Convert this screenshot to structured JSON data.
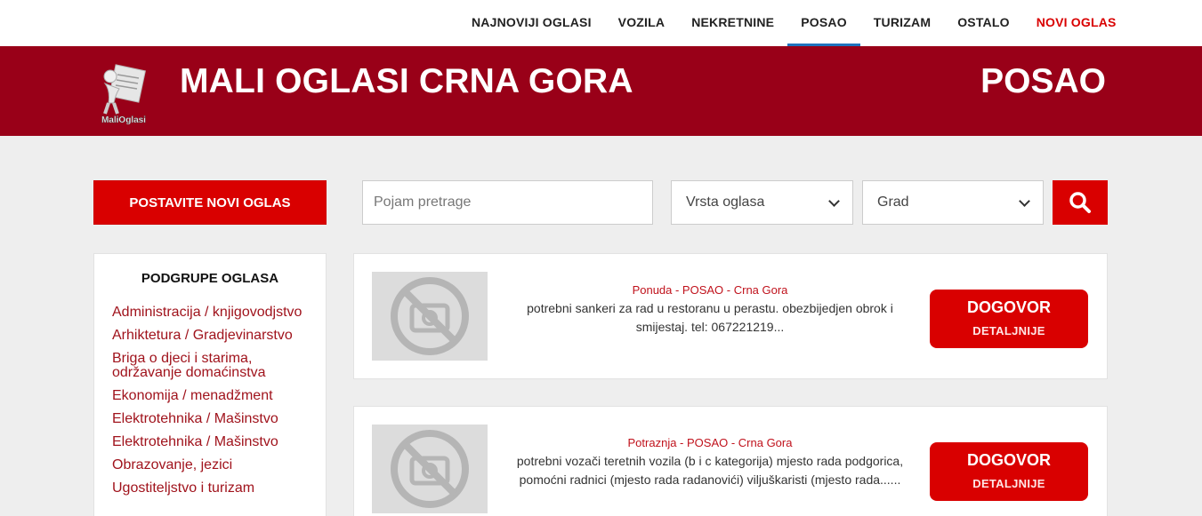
{
  "nav": {
    "items": [
      {
        "label": "NAJNOVIJI OGLASI"
      },
      {
        "label": "VOZILA"
      },
      {
        "label": "NEKRETNINE"
      },
      {
        "label": "POSAO"
      },
      {
        "label": "TURIZAM"
      },
      {
        "label": "OSTALO"
      },
      {
        "label": "NOVI OGLAS"
      }
    ],
    "active": "POSAO"
  },
  "header": {
    "logo_text": "MaliOglasi",
    "title": "MALI OGLASI CRNA GORA",
    "section": "POSAO"
  },
  "search": {
    "post_button": "POSTAVITE NOVI OGLAS",
    "placeholder": "Pojam pretrage",
    "type_select": "Vrsta oglasa",
    "city_select": "Grad"
  },
  "sidebar": {
    "title": "PODGRUPE OGLASA",
    "items": [
      "Administracija / knjigovodjstvo",
      "Arhiktetura / Gradjevinarstvo",
      "Briga o djeci i starima, održavanje domaćinstva",
      "Ekonomija / menadžment",
      "Elektrotehnika / Mašinstvo",
      "Elektrotehnika / Mašinstvo",
      "Obrazovanje, jezici",
      "Ugostiteljstvo i turizam"
    ]
  },
  "listings": [
    {
      "category": "Ponuda - POSAO - Crna Gora",
      "description": "potrebni sankeri za rad u restoranu u perastu. obezbijedjen obrok i smijestaj. tel: 067221219...",
      "price": "DOGOVOR",
      "details": "DETALJNIJE"
    },
    {
      "category": "Potraznja - POSAO - Crna Gora",
      "description": "potrebni vozači teretnih vozila (b i c kategorija) mjesto rada podgorica, pomoćni radnici (mjesto rada radanovići) viljuškaristi (mjesto rada......",
      "price": "DOGOVOR",
      "details": "DETALJNIJE"
    }
  ],
  "colors": {
    "brand_red": "#990018",
    "accent_red": "#d90000",
    "active_underline": "#1e73be"
  }
}
